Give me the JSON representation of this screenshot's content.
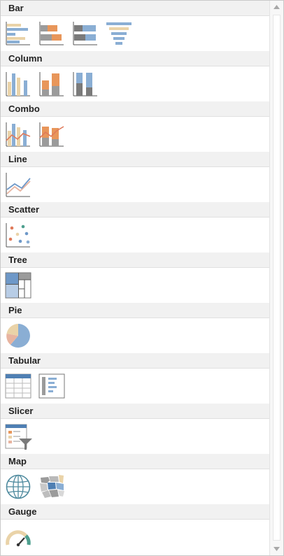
{
  "sections": [
    {
      "title": "Bar",
      "tiles": [
        "bar-stacked-bar-icon",
        "bar-100-stacked-icon",
        "bar-stacked-gray-icon",
        "funnel-icon"
      ]
    },
    {
      "title": "Column",
      "tiles": [
        "column-clustered-icon",
        "column-stacked-icon",
        "column-100-stacked-icon"
      ]
    },
    {
      "title": "Combo",
      "tiles": [
        "combo-line-column-icon",
        "combo-stacked-line-icon"
      ]
    },
    {
      "title": "Line",
      "tiles": [
        "line-chart-icon"
      ]
    },
    {
      "title": "Scatter",
      "tiles": [
        "scatter-chart-icon"
      ]
    },
    {
      "title": "Tree",
      "tiles": [
        "treemap-icon"
      ]
    },
    {
      "title": "Pie",
      "tiles": [
        "pie-chart-icon"
      ]
    },
    {
      "title": "Tabular",
      "tiles": [
        "table-icon",
        "card-list-icon"
      ]
    },
    {
      "title": "Slicer",
      "tiles": [
        "slicer-filter-icon"
      ]
    },
    {
      "title": "Map",
      "tiles": [
        "globe-map-icon",
        "filled-map-icon"
      ]
    },
    {
      "title": "Gauge",
      "tiles": [
        "gauge-icon"
      ]
    }
  ],
  "colors": {
    "blue": "#8aaed4",
    "orange": "#e8965a",
    "tan": "#ead3a8",
    "gray": "#9b9b9b",
    "red": "#e07a5a",
    "teal": "#4e9f8e"
  }
}
